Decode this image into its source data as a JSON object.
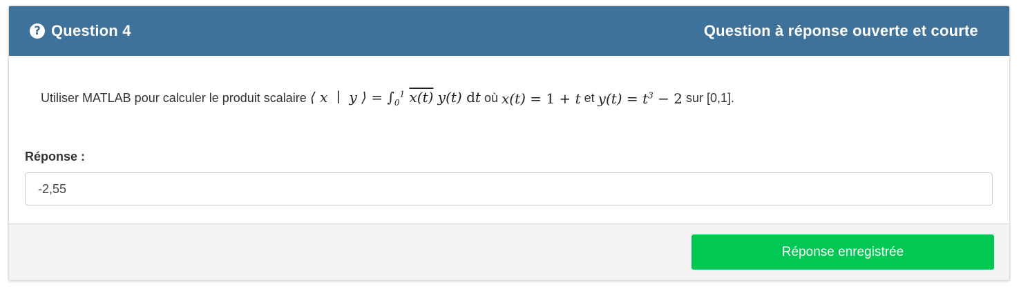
{
  "header": {
    "icon": "question-circle-icon",
    "title": "Question 4",
    "type_label": "Question à réponse ouverte et courte",
    "color": "#3f729b"
  },
  "question": {
    "intro": "Utiliser MATLAB pour calculer le produit scalaire",
    "formula_inner_product": "⟨ x  ∣  y ⟩ = ∫₀¹ x(t) y(t) dt",
    "connector_ou": "où",
    "formula_x": "x(t) = 1 + t",
    "connector_et": "et",
    "formula_y": "y(t) = t³ − 2",
    "outro": "sur [0,1]."
  },
  "answer": {
    "label": "Réponse :",
    "value": "-2,55"
  },
  "footer": {
    "submit_label": "Réponse enregistrée",
    "submit_color": "#00c853"
  }
}
